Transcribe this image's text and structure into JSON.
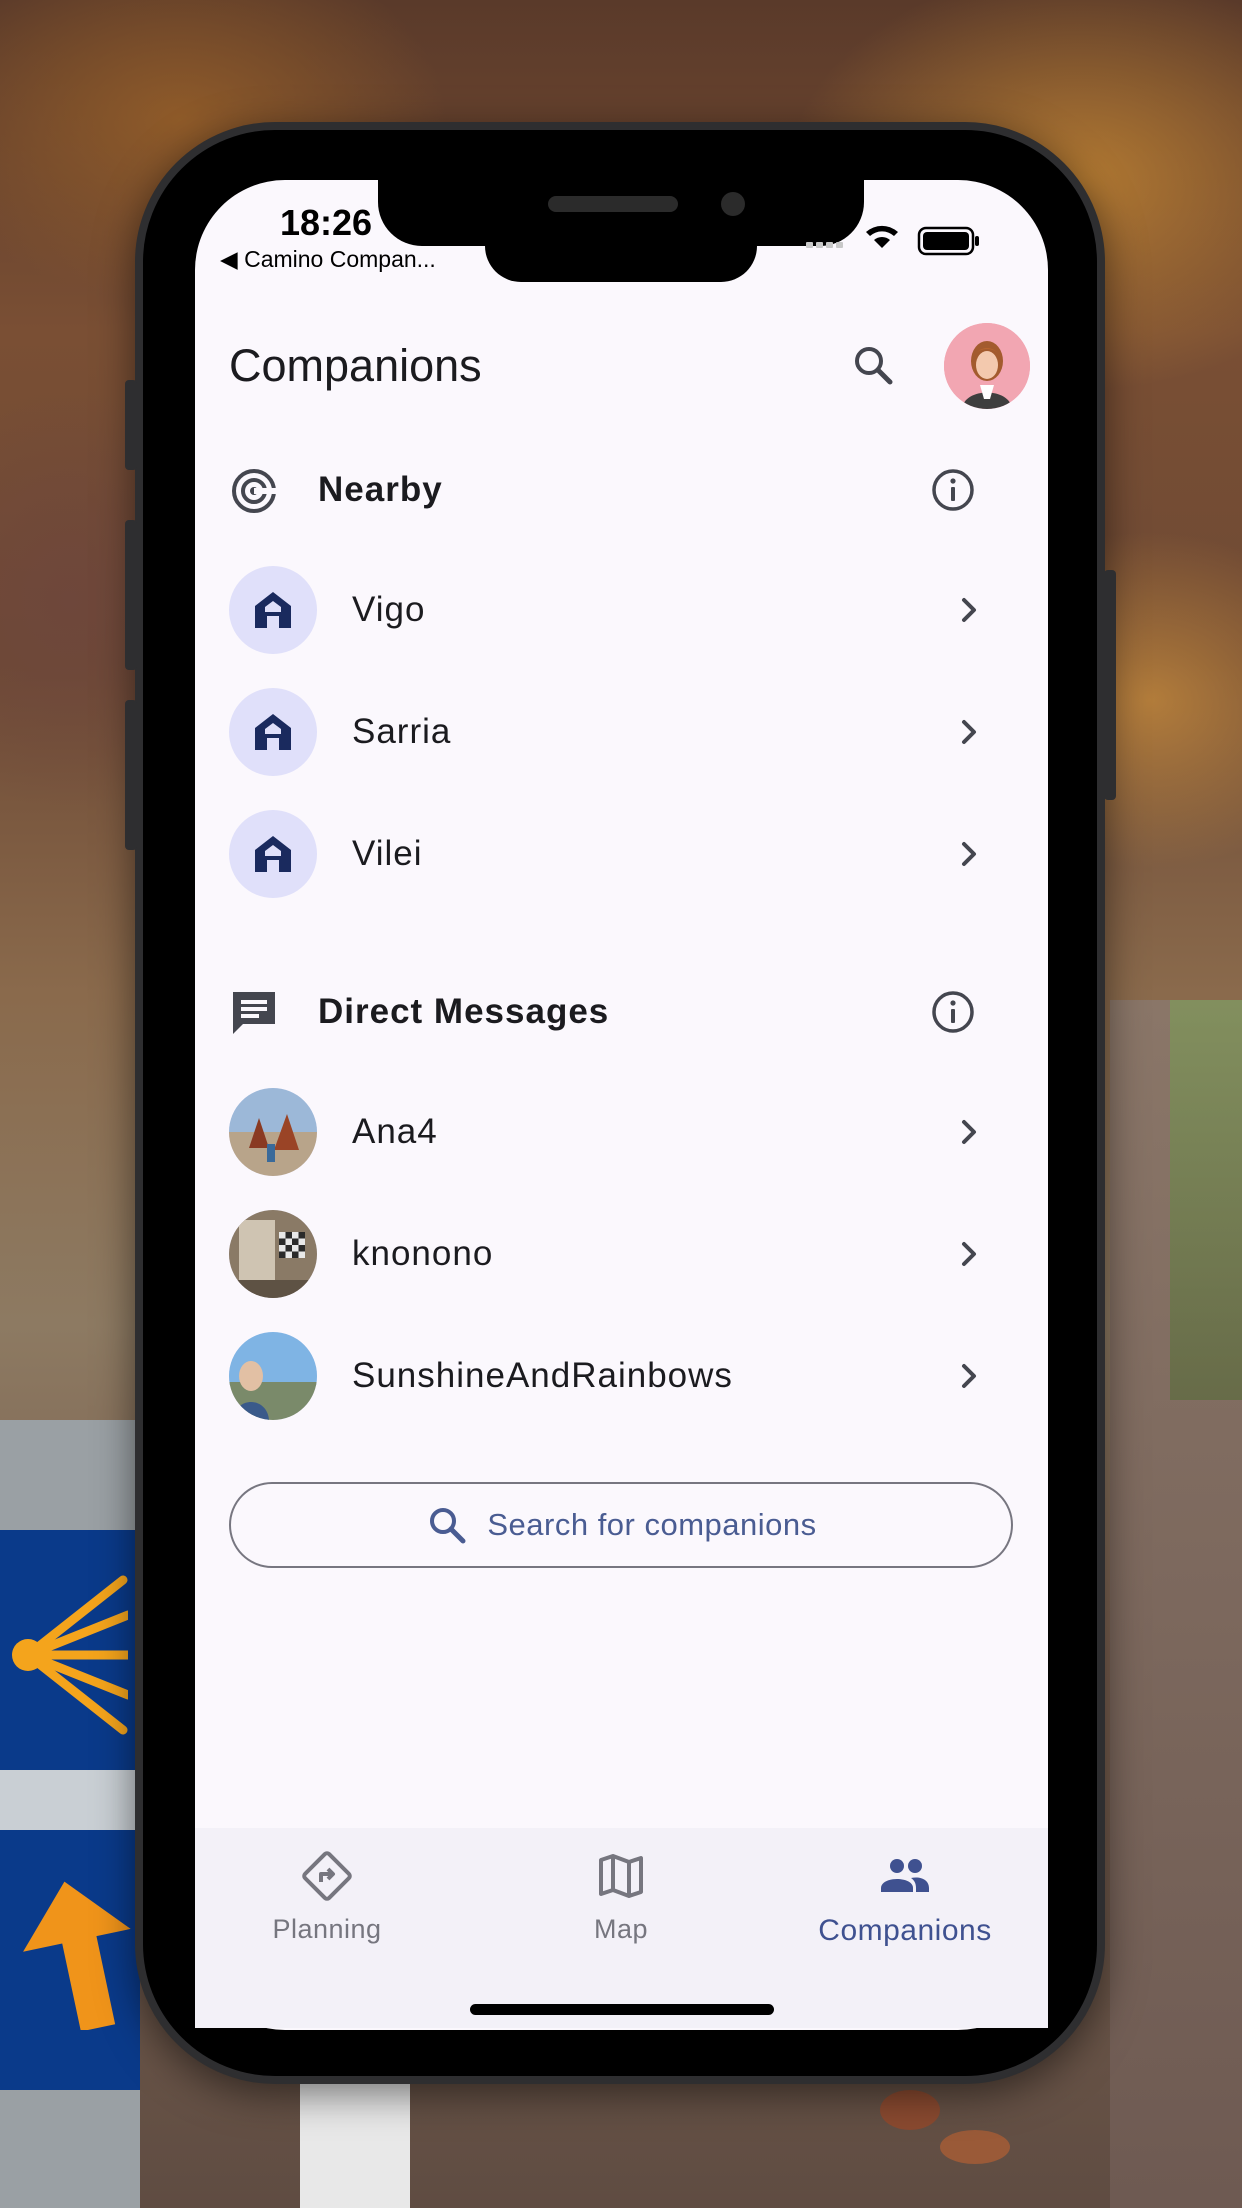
{
  "status_bar": {
    "time": "18:26",
    "back_app": "◀ Camino Compan..."
  },
  "app_bar": {
    "title": "Companions",
    "search_icon": "search-icon",
    "avatar": "user-avatar"
  },
  "nearby": {
    "title": "Nearby",
    "icon": "radar-icon",
    "info_icon": "info-icon",
    "items": [
      {
        "label": "Vigo",
        "icon": "home-icon"
      },
      {
        "label": "Sarria",
        "icon": "home-icon"
      },
      {
        "label": "Vilei",
        "icon": "home-icon"
      }
    ]
  },
  "direct_messages": {
    "title": "Direct Messages",
    "icon": "chat-icon",
    "info_icon": "info-icon",
    "items": [
      {
        "label": "Ana4",
        "avatar": "ana4-avatar"
      },
      {
        "label": "knonono",
        "avatar": "knonono-avatar"
      },
      {
        "label": "SunshineAndRainbows",
        "avatar": "sunshine-avatar"
      }
    ]
  },
  "search_companions": {
    "label": "Search for companions"
  },
  "bottom_nav": {
    "items": [
      {
        "label": "Planning",
        "icon": "route-icon",
        "active": false
      },
      {
        "label": "Map",
        "icon": "map-icon",
        "active": false
      },
      {
        "label": "Companions",
        "icon": "people-icon",
        "active": true
      }
    ]
  },
  "colors": {
    "accent": "#3f5190",
    "surface": "#fbf8fd",
    "tonal": "#e0e0fa",
    "icon_dark": "#1a2a5e"
  }
}
